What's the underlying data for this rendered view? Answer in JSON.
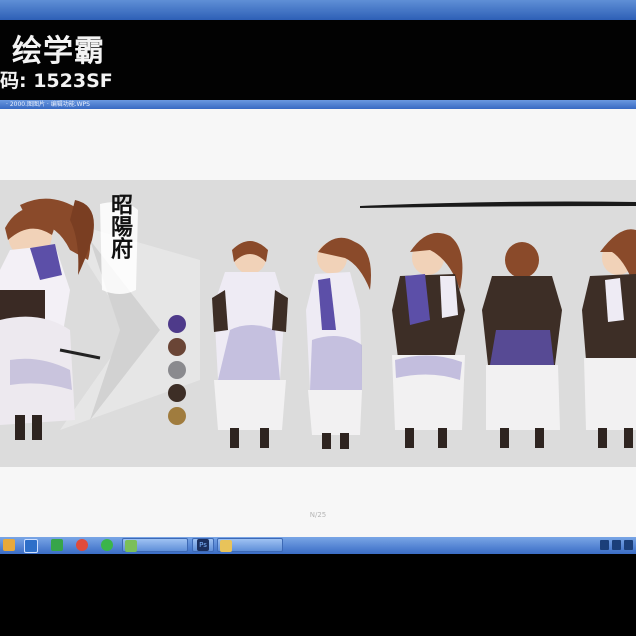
{
  "banner": {
    "title": "绘学霸",
    "code_line": "码: 1523SF"
  },
  "window": {
    "title": "· 2000.图图片 · 编辑功能.WPS"
  },
  "artwork": {
    "vertical_caption": "昭陽府",
    "palette": [
      "#4e3a8a",
      "#6a4536",
      "#8a8a8e",
      "#3d2e26",
      "#a07c3e"
    ],
    "page_number": "N/25"
  },
  "taskbar": {
    "icons": [
      "folder-icon",
      "explorer-icon",
      "qq-icon",
      "camera-icon",
      "chat-icon"
    ],
    "tasks": [
      {
        "name": "image-viewer-task",
        "label": ""
      },
      {
        "name": "photoshop-task",
        "label": "Ps"
      },
      {
        "name": "folder-task",
        "label": ""
      }
    ]
  }
}
